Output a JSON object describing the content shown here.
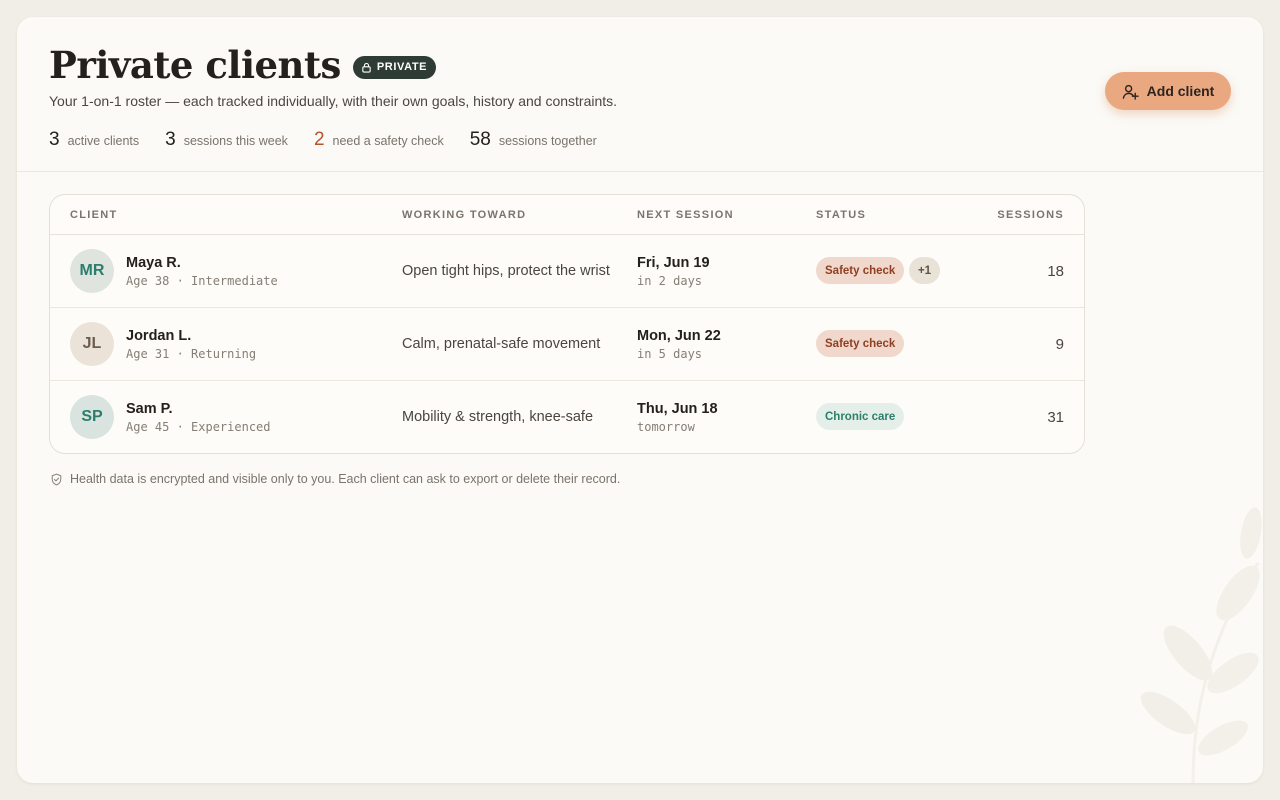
{
  "header": {
    "title": "Private clients",
    "badge": "PRIVATE",
    "subtitle": "Your 1-on-1 roster — each tracked individually, with their own goals, history and constraints.",
    "add_button": "Add client"
  },
  "stats": [
    {
      "value": "3",
      "label": "active clients"
    },
    {
      "value": "3",
      "label": "sessions this week"
    },
    {
      "value": "2",
      "label": "need a safety check"
    },
    {
      "value": "58",
      "label": "sessions together"
    }
  ],
  "table": {
    "columns": [
      "CLIENT",
      "WORKING TOWARD",
      "NEXT SESSION",
      "STATUS",
      "SESSIONS"
    ],
    "rows": [
      {
        "initials": "MR",
        "name": "Maya R.",
        "meta": "Age 38 · Intermediate",
        "goal": "Open tight hips, protect the wrist",
        "date": "Fri, Jun 19",
        "relative": "in 2 days",
        "status": "Safety check",
        "extra": "+1",
        "sessions": "18"
      },
      {
        "initials": "JL",
        "name": "Jordan L.",
        "meta": "Age 31 · Returning",
        "goal": "Calm, prenatal-safe movement",
        "date": "Mon, Jun 22",
        "relative": "in 5 days",
        "status": "Safety check",
        "sessions": "9"
      },
      {
        "initials": "SP",
        "name": "Sam P.",
        "meta": "Age 45 · Experienced",
        "goal": "Mobility & strength, knee-safe",
        "date": "Thu, Jun 18",
        "relative": "tomorrow",
        "status": "Chronic care",
        "sessions": "31"
      }
    ]
  },
  "footnote": "Health data is encrypted and visible only to you. Each client can ask to export or delete their record.",
  "colors": {
    "accent": "#eaa881",
    "warning": "#b5532e",
    "safety_pill": "#f1d8cc",
    "chronic_pill": "#e4efea",
    "badge": "#2f3b35"
  },
  "icons": {
    "badge": "lock-icon",
    "add_button": "user-plus-icon",
    "footnote": "shield-icon"
  }
}
